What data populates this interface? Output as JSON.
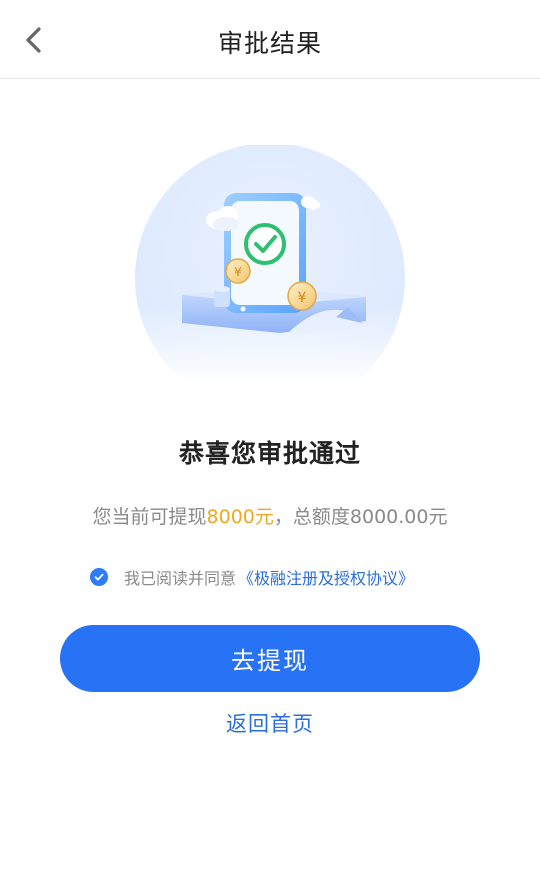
{
  "header": {
    "title": "审批结果",
    "back_icon": "chevron-left-icon"
  },
  "illustration": {
    "name": "approval-success-illustration",
    "icons": [
      "check-circle-icon",
      "yuan-coin-icon",
      "cloud-icon"
    ]
  },
  "result": {
    "headline": "恭喜您审批通过",
    "summary_prefix": "您当前可提现",
    "withdrawable_amount": "8000元",
    "summary_suffix": "，总额度8000.00元"
  },
  "agreement": {
    "checked": true,
    "prefix": "我已阅读并同意",
    "link_text": "《极融注册及授权协议》"
  },
  "actions": {
    "primary_label": "去提现",
    "secondary_label": "返回首页"
  },
  "colors": {
    "primary": "#2873f5",
    "link": "#2a6fdb",
    "amount": "#f0a824",
    "success": "#2fbf71"
  }
}
